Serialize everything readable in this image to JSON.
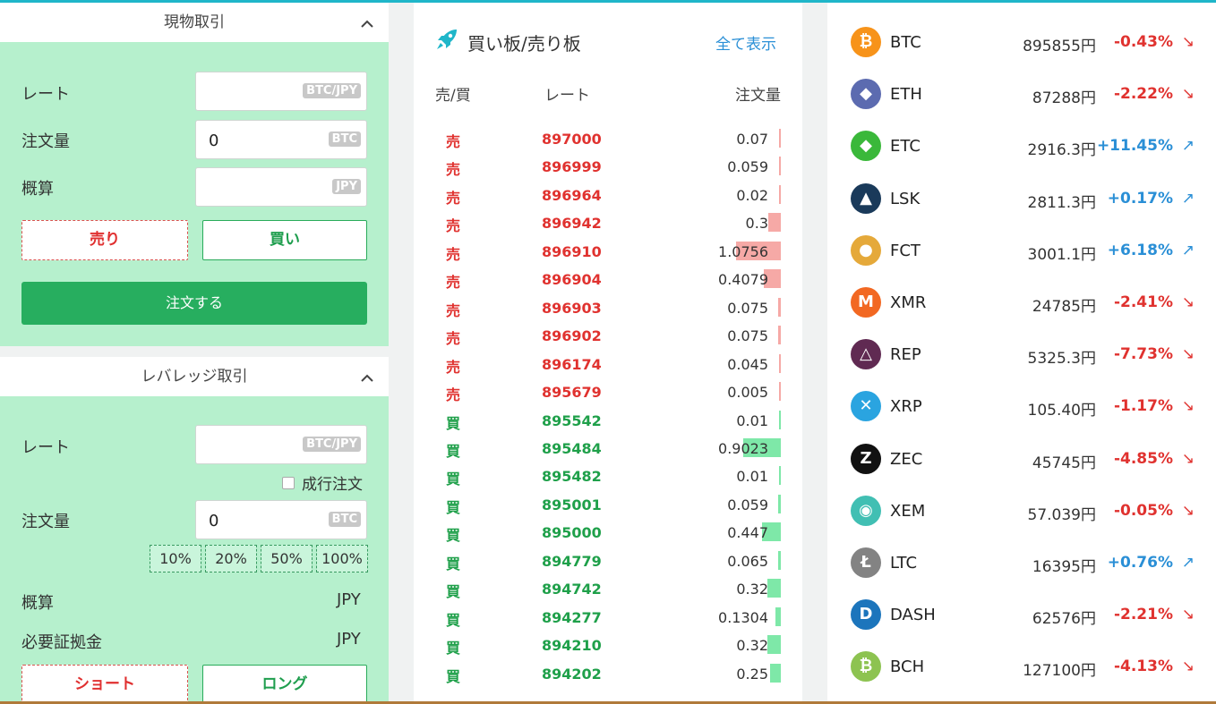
{
  "spot": {
    "title": "現物取引",
    "rate_label": "レート",
    "rate_unit": "BTC/JPY",
    "amount_label": "注文量",
    "amount_value": "0",
    "amount_unit": "BTC",
    "estimate_label": "概算",
    "estimate_unit": "JPY",
    "sell_label": "売り",
    "buy_label": "買い",
    "order_label": "注文する"
  },
  "leverage": {
    "title": "レバレッジ取引",
    "rate_label": "レート",
    "rate_unit": "BTC/JPY",
    "market_order_label": "成行注文",
    "amount_label": "注文量",
    "amount_value": "0",
    "amount_unit": "BTC",
    "percent_options": [
      "10%",
      "20%",
      "50%",
      "100%"
    ],
    "estimate_label": "概算",
    "estimate_value": "JPY",
    "margin_label": "必要証拠金",
    "margin_value": "JPY",
    "short_label": "ショート",
    "long_label": "ロング"
  },
  "orderbook": {
    "title": "買い板/売り板",
    "show_all": "全て表示",
    "col_side": "売/買",
    "col_rate": "レート",
    "col_qty": "注文量",
    "rows": [
      {
        "side": "売",
        "type": "sell",
        "rate": "897000",
        "qty": "0.07",
        "depth": 0.04
      },
      {
        "side": "売",
        "type": "sell",
        "rate": "896999",
        "qty": "0.059",
        "depth": 0.04
      },
      {
        "side": "売",
        "type": "sell",
        "rate": "896964",
        "qty": "0.02",
        "depth": 0.02
      },
      {
        "side": "売",
        "type": "sell",
        "rate": "896942",
        "qty": "0.3",
        "depth": 0.28
      },
      {
        "side": "売",
        "type": "sell",
        "rate": "896910",
        "qty": "1.0756",
        "depth": 1.0
      },
      {
        "side": "売",
        "type": "sell",
        "rate": "896904",
        "qty": "0.4079",
        "depth": 0.38
      },
      {
        "side": "売",
        "type": "sell",
        "rate": "896903",
        "qty": "0.075",
        "depth": 0.05
      },
      {
        "side": "売",
        "type": "sell",
        "rate": "896902",
        "qty": "0.075",
        "depth": 0.05
      },
      {
        "side": "売",
        "type": "sell",
        "rate": "896174",
        "qty": "0.045",
        "depth": 0.03
      },
      {
        "side": "売",
        "type": "sell",
        "rate": "895679",
        "qty": "0.005",
        "depth": 0.0
      },
      {
        "side": "買",
        "type": "buy",
        "rate": "895542",
        "qty": "0.01",
        "depth": 0.0
      },
      {
        "side": "買",
        "type": "buy",
        "rate": "895484",
        "qty": "0.9023",
        "depth": 0.84
      },
      {
        "side": "買",
        "type": "buy",
        "rate": "895482",
        "qty": "0.01",
        "depth": 0.0
      },
      {
        "side": "買",
        "type": "buy",
        "rate": "895001",
        "qty": "0.059",
        "depth": 0.05
      },
      {
        "side": "買",
        "type": "buy",
        "rate": "895000",
        "qty": "0.447",
        "depth": 0.42
      },
      {
        "side": "買",
        "type": "buy",
        "rate": "894779",
        "qty": "0.065",
        "depth": 0.05
      },
      {
        "side": "買",
        "type": "buy",
        "rate": "894742",
        "qty": "0.32",
        "depth": 0.3
      },
      {
        "side": "買",
        "type": "buy",
        "rate": "894277",
        "qty": "0.1304",
        "depth": 0.12
      },
      {
        "side": "買",
        "type": "buy",
        "rate": "894210",
        "qty": "0.32",
        "depth": 0.3
      },
      {
        "side": "買",
        "type": "buy",
        "rate": "894202",
        "qty": "0.25",
        "depth": 0.24
      }
    ],
    "colors": {
      "sell": "#e0322f",
      "buy": "#1fa04a",
      "sell_bar": "#f6a9a6",
      "buy_bar": "#7ee8a8"
    }
  },
  "tickers": [
    {
      "symbol": "BTC",
      "price": "895855円",
      "change": "-0.43%",
      "dir": "down",
      "icon": "btc-icon",
      "color": "#f7931a",
      "glyph": "₿"
    },
    {
      "symbol": "ETH",
      "price": "87288円",
      "change": "-2.22%",
      "dir": "down",
      "icon": "eth-icon",
      "color": "#5c6bb0",
      "glyph": "◆"
    },
    {
      "symbol": "ETC",
      "price": "2916.3円",
      "change": "+11.45%",
      "dir": "up",
      "icon": "etc-icon",
      "color": "#3ab83a",
      "glyph": "◆"
    },
    {
      "symbol": "LSK",
      "price": "2811.3円",
      "change": "+0.17%",
      "dir": "up",
      "icon": "lsk-icon",
      "color": "#1a3a5a",
      "glyph": "▲"
    },
    {
      "symbol": "FCT",
      "price": "3001.1円",
      "change": "+6.18%",
      "dir": "up",
      "icon": "fct-icon",
      "color": "#e5a93a",
      "glyph": "●"
    },
    {
      "symbol": "XMR",
      "price": "24785円",
      "change": "-2.41%",
      "dir": "down",
      "icon": "xmr-icon",
      "color": "#f26822",
      "glyph": "M"
    },
    {
      "symbol": "REP",
      "price": "5325.3円",
      "change": "-7.73%",
      "dir": "down",
      "icon": "rep-icon",
      "color": "#602a52",
      "glyph": "△"
    },
    {
      "symbol": "XRP",
      "price": "105.40円",
      "change": "-1.17%",
      "dir": "down",
      "icon": "xrp-icon",
      "color": "#2aa4e0",
      "glyph": "✕"
    },
    {
      "symbol": "ZEC",
      "price": "45745円",
      "change": "-4.85%",
      "dir": "down",
      "icon": "zec-icon",
      "color": "#111111",
      "glyph": "Z"
    },
    {
      "symbol": "XEM",
      "price": "57.039円",
      "change": "-0.05%",
      "dir": "down",
      "icon": "xem-icon",
      "color": "#41bfb3",
      "glyph": "◉"
    },
    {
      "symbol": "LTC",
      "price": "16395円",
      "change": "+0.76%",
      "dir": "up",
      "icon": "ltc-icon",
      "color": "#838383",
      "glyph": "Ł"
    },
    {
      "symbol": "DASH",
      "price": "62576円",
      "change": "-2.21%",
      "dir": "down",
      "icon": "dash-icon",
      "color": "#1c75bc",
      "glyph": "D"
    },
    {
      "symbol": "BCH",
      "price": "127100円",
      "change": "-4.13%",
      "dir": "down",
      "icon": "bch-icon",
      "color": "#8dc351",
      "glyph": "₿"
    }
  ],
  "arrows": {
    "down": "↘",
    "up": "↗"
  }
}
